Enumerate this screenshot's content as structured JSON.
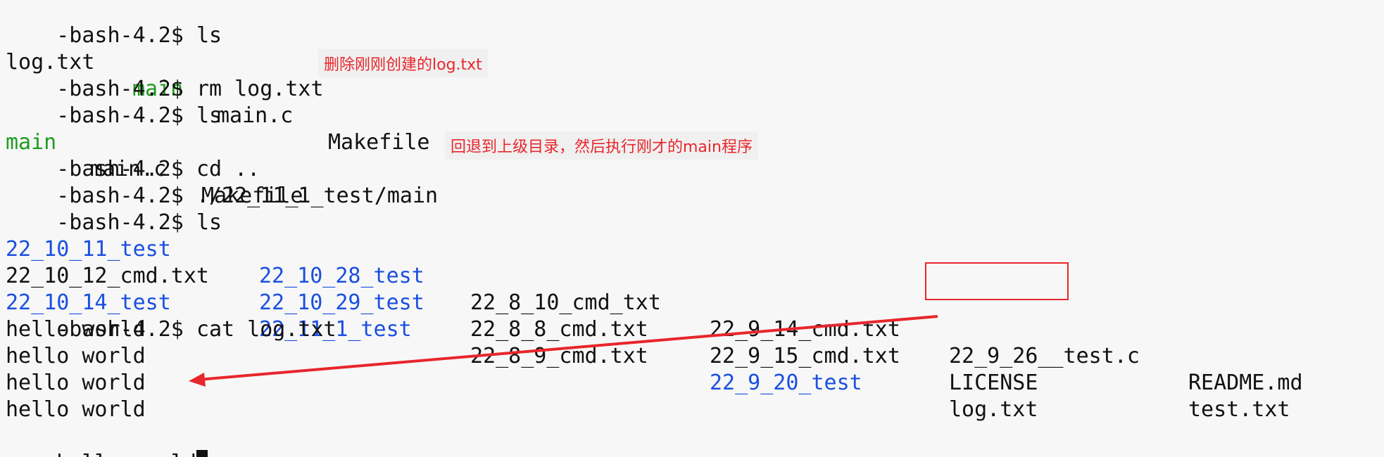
{
  "terminal": {
    "prompt": "-bash-4.2$ ",
    "lines": [
      {
        "cmd": "ls"
      },
      {
        "items": [
          {
            "text": "log.txt",
            "kind": "file"
          },
          {
            "text": "main",
            "kind": "exec"
          },
          {
            "text": "main.c",
            "kind": "file"
          },
          {
            "text": "Makefile",
            "kind": "file"
          }
        ]
      },
      {
        "cmd": "rm log.txt"
      },
      {
        "cmd": "ls"
      },
      {
        "items": [
          {
            "text": "main",
            "kind": "exec"
          },
          {
            "text": "main.c",
            "kind": "file"
          },
          {
            "text": "Makefile",
            "kind": "file"
          }
        ]
      },
      {
        "cmd": "cd .."
      },
      {
        "cmd": "./22_11_1_test/main"
      },
      {
        "cmd": "ls"
      }
    ],
    "listing": {
      "rows": [
        [
          {
            "text": "22_10_11_test",
            "kind": "dir"
          },
          {
            "text": "22_10_28_test",
            "kind": "dir"
          },
          {
            "text": "22_8_10_cmd_txt",
            "kind": "file"
          },
          {
            "text": "22_9_14_cmd.txt",
            "kind": "file"
          },
          {
            "text": "22_9_26__test.c",
            "kind": "file"
          },
          {
            "text": "README.md",
            "kind": "file"
          }
        ],
        [
          {
            "text": "22_10_12_cmd.txt",
            "kind": "file"
          },
          {
            "text": "22_10_29_test",
            "kind": "dir"
          },
          {
            "text": "22_8_8_cmd.txt",
            "kind": "file"
          },
          {
            "text": "22_9_15_cmd.txt",
            "kind": "file"
          },
          {
            "text": "LICENSE",
            "kind": "file"
          },
          {
            "text": "test.txt",
            "kind": "file"
          }
        ],
        [
          {
            "text": "22_10_14_test",
            "kind": "dir"
          },
          {
            "text": "22_11_1_test",
            "kind": "dir"
          },
          {
            "text": "22_8_9_cmd.txt",
            "kind": "file"
          },
          {
            "text": "22_9_20_test",
            "kind": "dir"
          },
          {
            "text": "log.txt",
            "kind": "file"
          }
        ]
      ]
    },
    "cat_cmd": "cat log.txt",
    "output": [
      "hello world",
      "hello world",
      "hello world",
      "hello world",
      "hello world"
    ]
  },
  "annotations": {
    "delete_note": "删除刚刚创建的log.txt",
    "run_note": "回退到上级目录，然后执行刚才的main程序"
  },
  "colors": {
    "background": "#f7f7f7",
    "text": "#111111",
    "executable": "#1f9d1f",
    "directory": "#1a4fe0",
    "annotation": "#e8262c"
  }
}
